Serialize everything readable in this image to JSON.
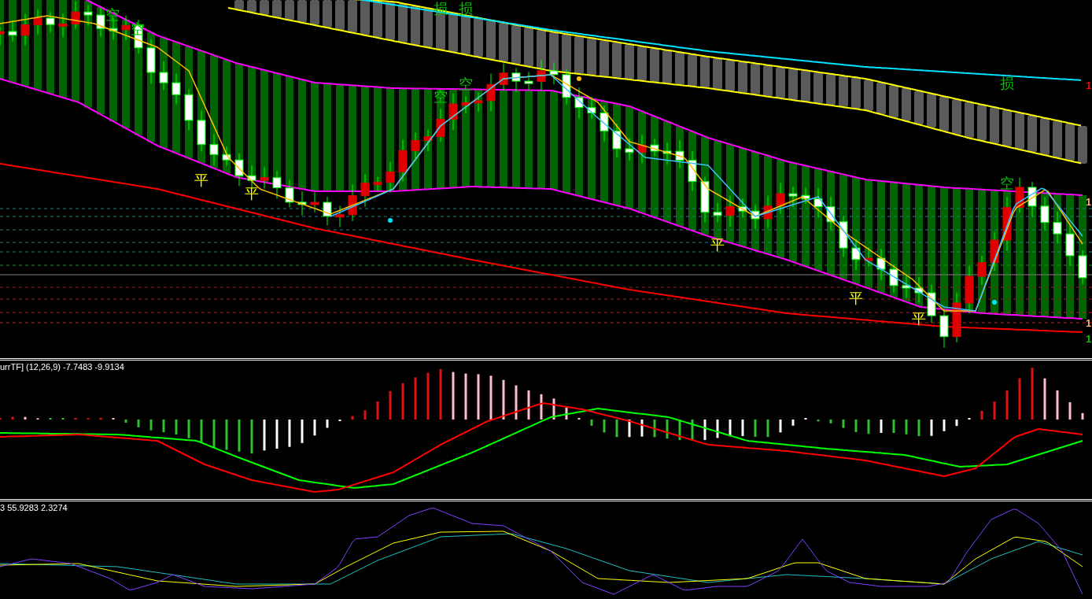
{
  "main_chart": {
    "signals": [
      {
        "kind": "open",
        "text": "空"
      },
      {
        "kind": "open",
        "text": "空"
      },
      {
        "kind": "close",
        "text": "平"
      },
      {
        "kind": "close",
        "text": "平"
      },
      {
        "kind": "stop",
        "text": "损"
      },
      {
        "kind": "open",
        "text": "空"
      },
      {
        "kind": "stop",
        "text": "损"
      },
      {
        "kind": "open",
        "text": "空"
      },
      {
        "kind": "close",
        "text": "平"
      },
      {
        "kind": "close",
        "text": "平"
      },
      {
        "kind": "close",
        "text": "平"
      },
      {
        "kind": "stop",
        "text": "损"
      },
      {
        "kind": "open",
        "text": "空"
      }
    ],
    "price_scale": [
      {
        "text": "1",
        "color": "#ff0000"
      },
      {
        "text": "1",
        "color": "#ffb070"
      },
      {
        "text": "1",
        "color": "#ffb070"
      },
      {
        "text": "1",
        "color": "#00c800"
      }
    ]
  },
  "macd_panel": {
    "label": "urrTF] (12,26,9) -7.7483 -9.9134"
  },
  "oscillator_panel": {
    "label": "3 55.9283 2.3274"
  }
}
